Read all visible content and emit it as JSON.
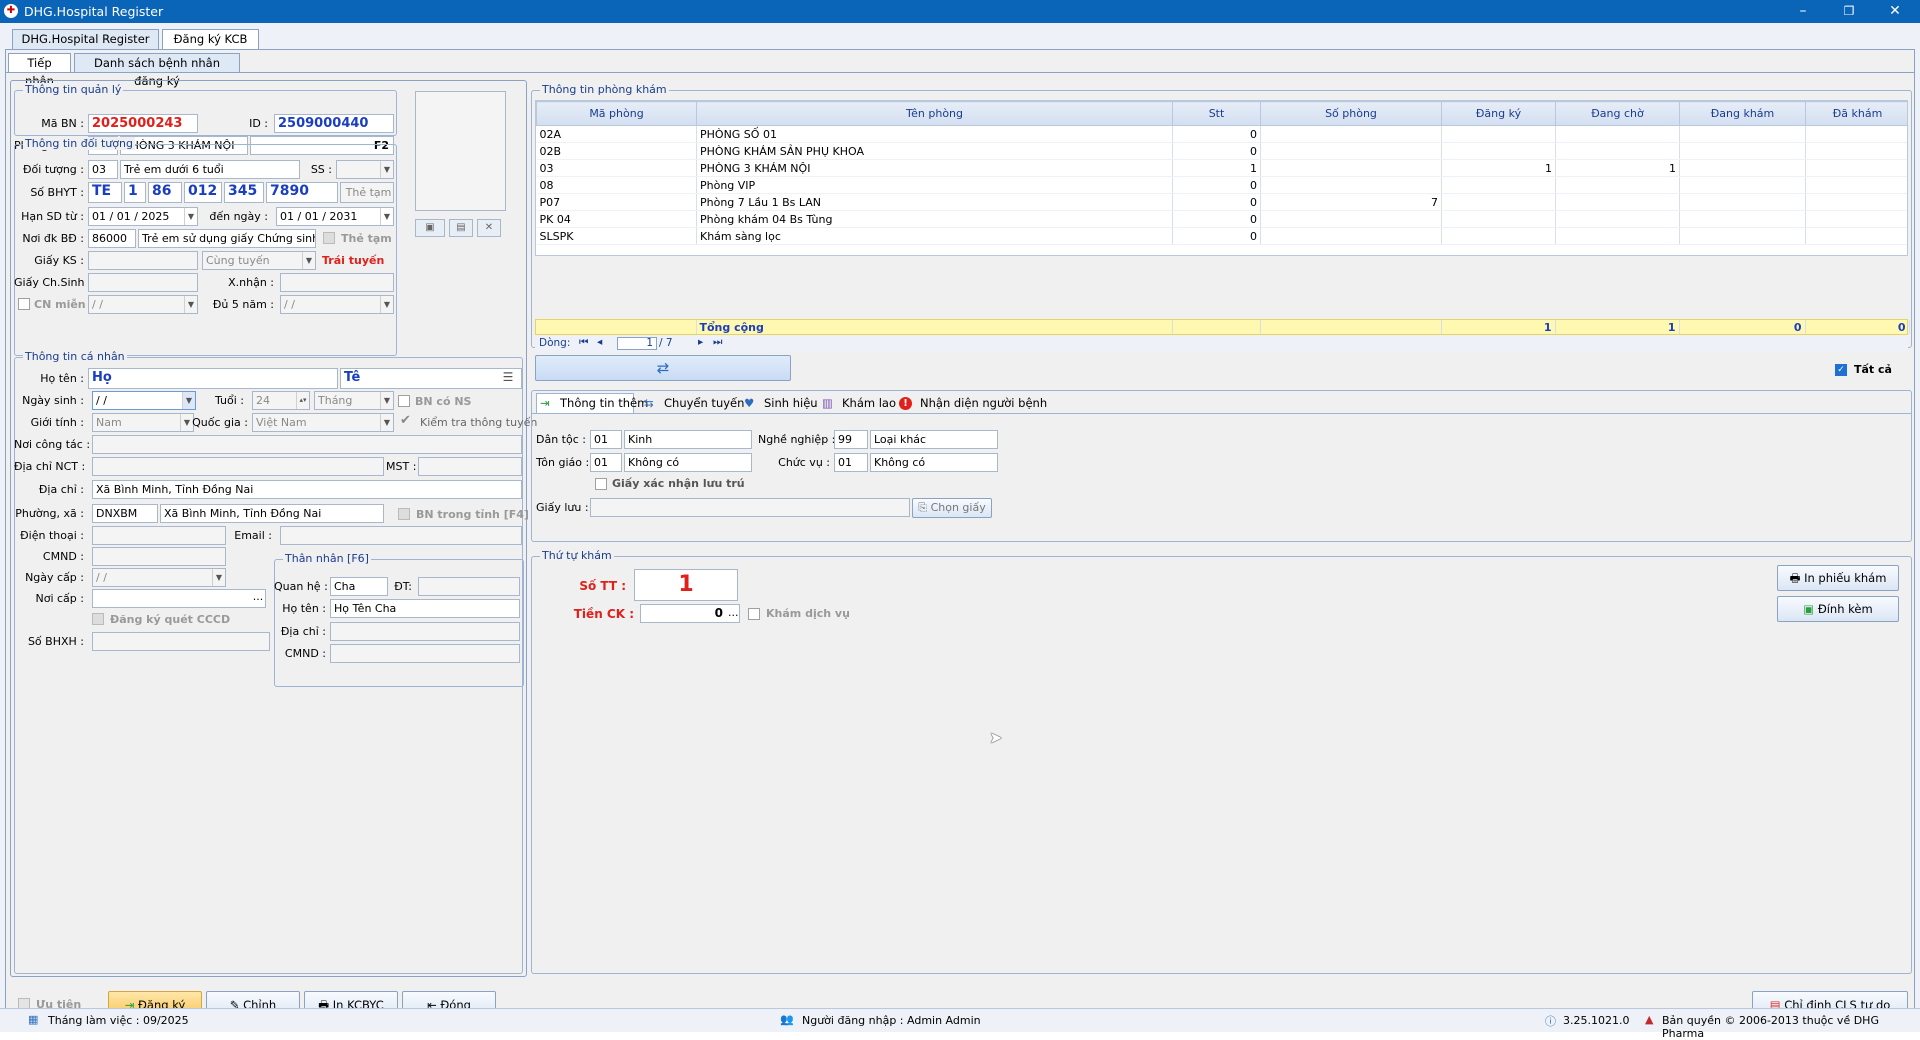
{
  "window": {
    "title": "DHG.Hospital Register"
  },
  "top_tabs": [
    "DHG.Hospital Register",
    "Đăng ký KCB"
  ],
  "sub_tabs": [
    "Tiếp nhận",
    "Danh sách bệnh nhân đăng ký"
  ],
  "management": {
    "group_title": "Thông tin quản lý",
    "ma_bn_label": "Mã BN :",
    "ma_bn": "2025000243",
    "id_label": "ID :",
    "id": "2509000440",
    "phong_kham_label": "Phòng khám :",
    "phong_kham_code": "03",
    "phong_kham_name": "PHÒNG 3 KHÁM NỘI",
    "f2": "F2"
  },
  "subject": {
    "group_title": "Thông tin đối tượng",
    "doi_tuong_label": "Đối tượng :",
    "doi_tuong_code": "03",
    "doi_tuong_name": "Trẻ em dưới 6 tuổi",
    "ss_label": "SS :",
    "bhyt_label": "Số BHYT :",
    "bhyt": [
      "TE",
      "1",
      "86",
      "012",
      "345",
      "7890"
    ],
    "the_tam_btn": "Thẻ tạm",
    "han_sd_label": "Hạn SD từ :",
    "han_from": "01 / 01 / 2025",
    "den_ngay_label": "đến ngày :",
    "han_to": "01 / 01 / 2031",
    "noi_dk_label": "Nơi đk BĐ :",
    "noi_dk_code": "86000",
    "noi_dk_name": "Trẻ em sử dụng giấy Chứng sinh - Kh",
    "the_tam_chk": "Thẻ tạm",
    "giay_ks_label": "Giấy KS :",
    "cung_tuyen": "Cùng tuyến",
    "trai_tuyen": "Trái tuyến",
    "giay_chsinh_label": "Giấy Ch.Sinh :",
    "xnhan_label": "X.nhận :",
    "cn_mien": "CN miễn",
    "du5nam_label": "Đủ 5 năm :",
    "date_blank": "  /    /"
  },
  "personal": {
    "group_title": "Thông tin cá nhân",
    "ho_ten_label": "Họ tên :",
    "ho": "Họ",
    "ten": "Tê",
    "ngay_sinh_label": "Ngày sinh :",
    "ngay_sinh": "  /    /",
    "tuoi_label": "Tuổi :",
    "tuoi": "24",
    "thang": "Tháng",
    "bn_co_ns": "BN có NS",
    "gioi_tinh_label": "Giới tính :",
    "gioi_tinh": "Nam",
    "quoc_gia_label": "Quốc gia :",
    "quoc_gia": "Việt Nam",
    "kiem_tra": "Kiểm tra thông tuyến",
    "noi_cong_tac_label": "Nơi công tác :",
    "dia_chi_nct_label": "Địa chỉ NCT :",
    "mst_label": "MST :",
    "dia_chi_label": "Địa chỉ :",
    "dia_chi": "Xã Bình Minh, Tỉnh Đồng Nai",
    "phuong_xa_label": "Phường, xã :",
    "phuong_xa_code": "DNXBM",
    "phuong_xa_name": "Xã Bình Minh, Tỉnh Đồng Nai",
    "bn_trong_tinh": "BN trong tỉnh [F4]",
    "dien_thoai_label": "Điện thoại :",
    "email_label": "Email :",
    "cmnd_label": "CMND :",
    "ngay_cap_label": "Ngày cấp :",
    "noi_cap_label": "Nơi cấp :",
    "dk_quet": "Đăng ký quét CCCD",
    "so_bhxh_label": "Số BHXH :",
    "than_nhan": {
      "title": "Thân nhân [F6]",
      "quan_he_label": "Quan hệ :",
      "quan_he": "Cha",
      "dt_label": "ĐT:",
      "ho_ten_label": "Họ tên :",
      "ho_ten": "Họ Tên Cha",
      "dia_chi_label": "Địa chỉ :",
      "cmnd_label": "CMND :"
    }
  },
  "clinic": {
    "group_title": "Thông tin phòng khám",
    "headers": [
      "Mã phòng",
      "Tên phòng",
      "Stt",
      "Số phòng",
      "Đăng ký",
      "Đang chờ",
      "Đang khám",
      "Đã khám"
    ],
    "rows": [
      [
        "02A",
        "PHÒNG SỐ 01",
        "0",
        "",
        "",
        "",
        "",
        ""
      ],
      [
        "02B",
        "PHÒNG KHÁM SẢN PHỤ KHOA",
        "0",
        "",
        "",
        "",
        "",
        ""
      ],
      [
        "03",
        "PHÒNG 3 KHÁM NỘI",
        "1",
        "",
        "1",
        "1",
        "",
        ""
      ],
      [
        "08",
        "Phòng VIP",
        "0",
        "",
        "",
        "",
        "",
        ""
      ],
      [
        "P07",
        "Phòng 7 Lầu 1 Bs LAN",
        "0",
        "7",
        "",
        "",
        "",
        ""
      ],
      [
        "PK 04",
        "Phòng khám 04 Bs Tùng",
        "0",
        "",
        "",
        "",
        "",
        ""
      ],
      [
        "SLSPK",
        "Khám sàng lọc",
        "0",
        "",
        "",
        "",
        "",
        ""
      ]
    ],
    "total_label": "Tổng cộng",
    "totals": [
      "1",
      "1",
      "0",
      "0"
    ],
    "nav_label": "Dòng:",
    "nav_current": "1",
    "nav_total": "/ 7",
    "tat_ca": "Tất cả"
  },
  "info_tabs": [
    "Thông tin thêm",
    "Chuyển tuyến",
    "Sinh hiệu",
    "Khám lao",
    "Nhận diện người bệnh"
  ],
  "extra": {
    "dan_toc_label": "Dân tộc :",
    "dan_toc_code": "01",
    "dan_toc": "Kinh",
    "nghe_nghiep_label": "Nghề nghiệp :",
    "nghe_nghiep_code": "99",
    "nghe_nghiep": "Loại khác",
    "ton_giao_label": "Tôn giáo :",
    "ton_giao_code": "01",
    "ton_giao": "Không có",
    "chuc_vu_label": "Chức vụ :",
    "chuc_vu_code": "01",
    "chuc_vu": "Không có",
    "giay_xac_nhan": "Giấy xác nhận lưu trú",
    "giay_luu_label": "Giấy lưu :",
    "chon_giay": "Chọn giấy"
  },
  "order": {
    "group_title": "Thứ tự khám",
    "so_tt_label": "Số TT :",
    "so_tt": "1",
    "tien_ck_label": "Tiền CK :",
    "tien_ck": "0",
    "kham_dich_vu": "Khám dịch vụ",
    "in_phieu": "In phiếu khám",
    "dinh_kem": "Đính kèm"
  },
  "bottom": {
    "uu_tien": "Ưu tiên",
    "dang_ky": "Đăng ký",
    "chinh": "Chỉnh",
    "in_kcbyc": "In KCBYC",
    "dong": "Đóng",
    "chi_dinh": "Chỉ định CLS tự do"
  },
  "status": {
    "thang": "Tháng làm việc : 09/2025",
    "user": "Người đăng nhập : Admin Admin",
    "version": "3.25.1021.0",
    "copyright": "Bản quyền © 2006-2013 thuộc về DHG Pharma"
  },
  "colors": {
    "title_bar": "#0a64b8",
    "accent_red": "#e0201a",
    "accent_blue": "#1a3ec0",
    "total_row": "#fff8b0"
  }
}
